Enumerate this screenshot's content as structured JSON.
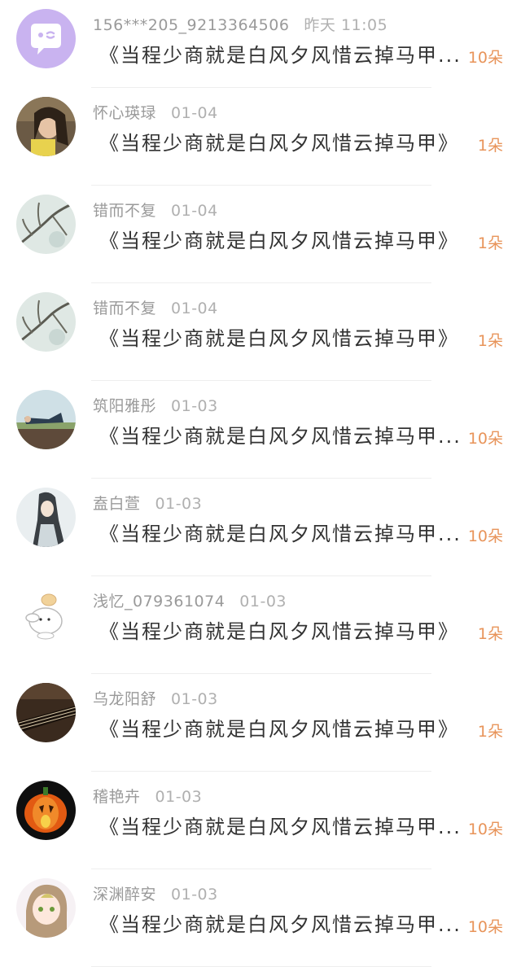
{
  "colors": {
    "accent": "#e8945a",
    "name": "#9a9a9a",
    "message": "#333333",
    "system_avatar": "#c9b3f0"
  },
  "items": [
    {
      "name": "156***205_9213364506",
      "time": "昨天 11:05",
      "message": "《当程少商就是白风夕风惜云掉马甲...",
      "count": "10朵",
      "avatar": "chat-bubble-icon"
    },
    {
      "name": "怀心瑛琭",
      "time": "01-04",
      "message": "《当程少商就是白风夕风惜云掉马甲》",
      "count": "1朵",
      "avatar": "girl-photo"
    },
    {
      "name": "错而不复",
      "time": "01-04",
      "message": "《当程少商就是白风夕风惜云掉马甲》",
      "count": "1朵",
      "avatar": "branch-photo"
    },
    {
      "name": "错而不复",
      "time": "01-04",
      "message": "《当程少商就是白风夕风惜云掉马甲》",
      "count": "1朵",
      "avatar": "branch-photo"
    },
    {
      "name": "筑阳雅彤",
      "time": "01-03",
      "message": "《当程少商就是白风夕风惜云掉马甲...",
      "count": "10朵",
      "avatar": "lying-person-photo"
    },
    {
      "name": "盍白萱",
      "time": "01-03",
      "message": "《当程少商就是白风夕风惜云掉马甲...",
      "count": "10朵",
      "avatar": "ancient-figure-drawing"
    },
    {
      "name": "浅忆_079361074",
      "time": "01-03",
      "message": "《当程少商就是白风夕风惜云掉马甲》",
      "count": "1朵",
      "avatar": "cartoon-dog"
    },
    {
      "name": "乌龙阳舒",
      "time": "01-03",
      "message": "《当程少商就是白风夕风惜云掉马甲》",
      "count": "1朵",
      "avatar": "guqin-photo"
    },
    {
      "name": "稽艳卉",
      "time": "01-03",
      "message": "《当程少商就是白风夕风惜云掉马甲...",
      "count": "10朵",
      "avatar": "pumpkin-lantern"
    },
    {
      "name": "深渊醉安",
      "time": "01-03",
      "message": "《当程少商就是白风夕风惜云掉马甲...",
      "count": "10朵",
      "avatar": "anime-girl"
    }
  ]
}
